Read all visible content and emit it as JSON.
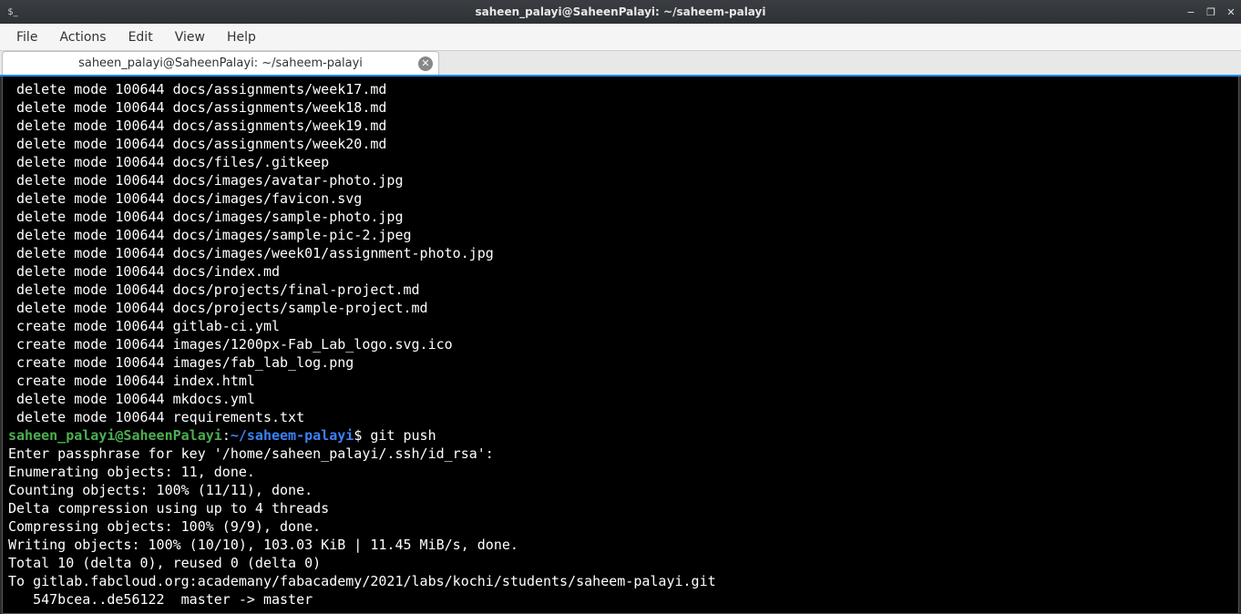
{
  "titlebar": {
    "icon_label": "$_",
    "title": "saheen_palayi@SaheenPalayi: ~/saheem-palayi"
  },
  "menubar": {
    "items": [
      "File",
      "Actions",
      "Edit",
      "View",
      "Help"
    ]
  },
  "tab": {
    "title": "saheen_palayi@SaheenPalayi: ~/saheem-palayi"
  },
  "terminal": {
    "delete_lines": [
      " delete mode 100644 docs/assignments/week17.md",
      " delete mode 100644 docs/assignments/week18.md",
      " delete mode 100644 docs/assignments/week19.md",
      " delete mode 100644 docs/assignments/week20.md",
      " delete mode 100644 docs/files/.gitkeep",
      " delete mode 100644 docs/images/avatar-photo.jpg",
      " delete mode 100644 docs/images/favicon.svg",
      " delete mode 100644 docs/images/sample-photo.jpg",
      " delete mode 100644 docs/images/sample-pic-2.jpeg",
      " delete mode 100644 docs/images/week01/assignment-photo.jpg",
      " delete mode 100644 docs/index.md",
      " delete mode 100644 docs/projects/final-project.md",
      " delete mode 100644 docs/projects/sample-project.md",
      " create mode 100644 gitlab-ci.yml",
      " create mode 100644 images/1200px-Fab_Lab_logo.svg.ico",
      " create mode 100644 images/fab_lab_log.png",
      " create mode 100644 index.html",
      " delete mode 100644 mkdocs.yml",
      " delete mode 100644 requirements.txt"
    ],
    "prompt_user": "saheen_palayi@SaheenPalayi",
    "prompt_sep": ":",
    "prompt_path": "~/saheem-palayi",
    "prompt_dollar": "$",
    "command": " git push",
    "push_output": [
      "Enter passphrase for key '/home/saheen_palayi/.ssh/id_rsa':",
      "Enumerating objects: 11, done.",
      "Counting objects: 100% (11/11), done.",
      "Delta compression using up to 4 threads",
      "Compressing objects: 100% (9/9), done.",
      "Writing objects: 100% (10/10), 103.03 KiB | 11.45 MiB/s, done.",
      "Total 10 (delta 0), reused 0 (delta 0)",
      "To gitlab.fabcloud.org:academany/fabacademy/2021/labs/kochi/students/saheem-palayi.git",
      "   547bcea..de56122  master -> master"
    ]
  }
}
